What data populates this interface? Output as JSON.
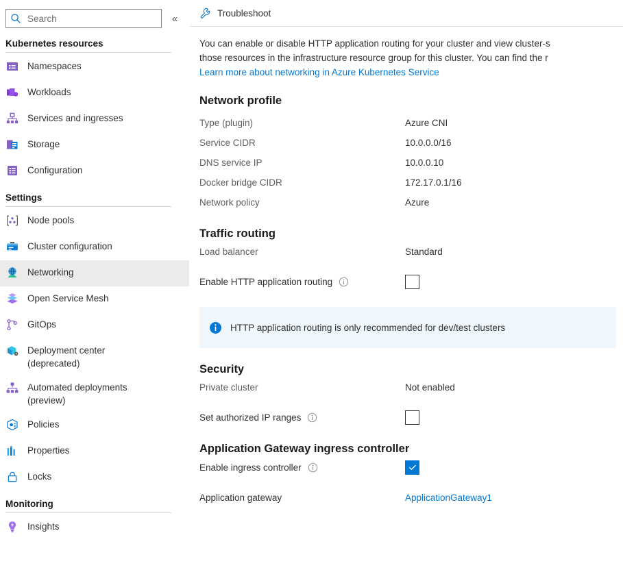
{
  "sidebar": {
    "search": {
      "placeholder": "Search",
      "value": "",
      "icon": "search-icon"
    },
    "collapse_label": "«",
    "groups": [
      {
        "title": "Kubernetes resources",
        "items": [
          {
            "label": "Namespaces",
            "icon": "namespaces-icon",
            "selected": false
          },
          {
            "label": "Workloads",
            "icon": "workloads-icon",
            "selected": false
          },
          {
            "label": "Services and ingresses",
            "icon": "services-icon",
            "selected": false
          },
          {
            "label": "Storage",
            "icon": "storage-icon",
            "selected": false
          },
          {
            "label": "Configuration",
            "icon": "configuration-icon",
            "selected": false
          }
        ]
      },
      {
        "title": "Settings",
        "items": [
          {
            "label": "Node pools",
            "icon": "node-pools-icon",
            "selected": false
          },
          {
            "label": "Cluster configuration",
            "icon": "cluster-configuration-icon",
            "selected": false
          },
          {
            "label": "Networking",
            "icon": "networking-icon",
            "selected": true
          },
          {
            "label": "Open Service Mesh",
            "icon": "open-service-mesh-icon",
            "selected": false
          },
          {
            "label": "GitOps",
            "icon": "gitops-icon",
            "selected": false
          },
          {
            "label": "Deployment center\n(deprecated)",
            "icon": "deployment-center-icon",
            "selected": false
          },
          {
            "label": "Automated deployments\n(preview)",
            "icon": "automated-deployments-icon",
            "selected": false
          },
          {
            "label": "Policies",
            "icon": "policies-icon",
            "selected": false
          },
          {
            "label": "Properties",
            "icon": "properties-icon",
            "selected": false
          },
          {
            "label": "Locks",
            "icon": "locks-icon",
            "selected": false
          }
        ]
      },
      {
        "title": "Monitoring",
        "items": [
          {
            "label": "Insights",
            "icon": "insights-icon",
            "selected": false
          }
        ]
      }
    ]
  },
  "commandbar": {
    "troubleshoot_label": "Troubleshoot",
    "troubleshoot_icon": "wrench-icon"
  },
  "description": {
    "line1": "You can enable or disable HTTP application routing for your cluster and view cluster-s",
    "line2": "those resources in the infrastructure resource group for this cluster. You can find the r",
    "link": "Learn more about networking in Azure Kubernetes Service"
  },
  "network_profile": {
    "heading": "Network profile",
    "rows": [
      {
        "key": "Type (plugin)",
        "value": "Azure CNI"
      },
      {
        "key": "Service CIDR",
        "value": "10.0.0.0/16"
      },
      {
        "key": "DNS service IP",
        "value": "10.0.0.10"
      },
      {
        "key": "Docker bridge CIDR",
        "value": "172.17.0.1/16"
      },
      {
        "key": "Network policy",
        "value": "Azure"
      }
    ]
  },
  "traffic_routing": {
    "heading": "Traffic routing",
    "load_balancer_label": "Load balancer",
    "load_balancer_value": "Standard",
    "http_routing_label": "Enable HTTP application routing",
    "http_routing_checked": false
  },
  "banner": {
    "icon": "info-filled-icon",
    "text": "HTTP application routing is only recommended for dev/test clusters",
    "background": "#eff6fc"
  },
  "security": {
    "heading": "Security",
    "private_cluster_label": "Private cluster",
    "private_cluster_value": "Not enabled",
    "authorized_ip_label": "Set authorized IP ranges",
    "authorized_ip_checked": false
  },
  "app_gateway": {
    "heading": "Application Gateway ingress controller",
    "enable_label": "Enable ingress controller",
    "enable_checked": true,
    "gateway_label": "Application gateway",
    "gateway_value": "ApplicationGateway1"
  },
  "colors": {
    "accent": "#0078d4",
    "link": "#0078d4",
    "selected_row": "#edebe9",
    "banner_bg": "#eff6fc",
    "scrollbar_thumb": "#c1c1c1"
  }
}
